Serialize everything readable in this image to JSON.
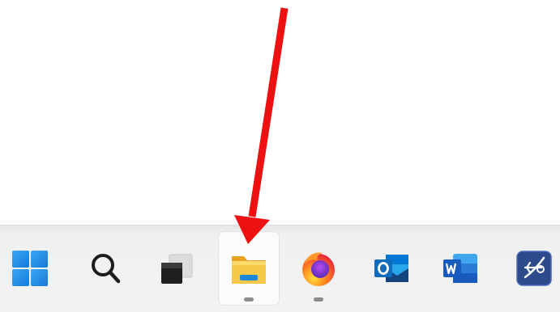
{
  "screen": {
    "edge_text": "(",
    "quote_text": "”"
  },
  "annotation": {
    "arrow_color": "#ee1111",
    "points_to": "file-explorer"
  },
  "taskbar": {
    "items": [
      {
        "id": "start",
        "icon": "windows-start-icon",
        "active": false,
        "running": false
      },
      {
        "id": "search",
        "icon": "search-icon",
        "active": false,
        "running": false
      },
      {
        "id": "task-view",
        "icon": "task-view-icon",
        "active": false,
        "running": false
      },
      {
        "id": "file-explorer",
        "icon": "folder-icon",
        "active": true,
        "running": true
      },
      {
        "id": "firefox",
        "icon": "firefox-icon",
        "active": false,
        "running": true
      },
      {
        "id": "outlook",
        "icon": "outlook-icon",
        "active": false,
        "running": false
      },
      {
        "id": "word",
        "icon": "word-icon",
        "active": false,
        "running": false
      },
      {
        "id": "pinned-app",
        "icon": "compass-app-icon",
        "active": false,
        "running": false
      }
    ],
    "colors": {
      "windows_blue": "#1f8ee8",
      "folder_yellow": "#f5c342",
      "outlook_blue": "#0f6cbd",
      "word_blue": "#185abd",
      "firefox_orange": "#ff7139"
    }
  }
}
